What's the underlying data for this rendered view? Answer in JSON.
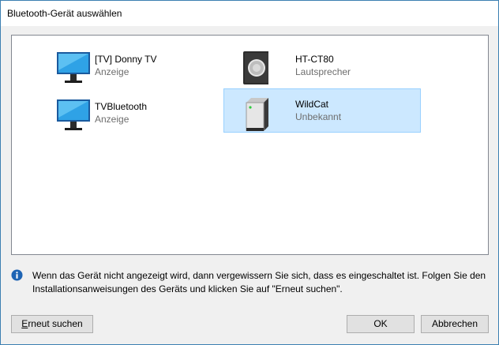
{
  "window": {
    "title": "Bluetooth-Gerät auswählen"
  },
  "devices": [
    {
      "name": "[TV] Donny TV",
      "type": "Anzeige",
      "icon": "monitor-icon",
      "selected": false
    },
    {
      "name": "HT-CT80",
      "type": "Lautsprecher",
      "icon": "speaker-icon",
      "selected": false
    },
    {
      "name": "TVBluetooth",
      "type": "Anzeige",
      "icon": "monitor-icon",
      "selected": false
    },
    {
      "name": "WildCat",
      "type": "Unbekannt",
      "icon": "unknown-device-icon",
      "selected": true
    }
  ],
  "info": {
    "icon": "info-icon",
    "text": "Wenn das Gerät nicht angezeigt wird, dann vergewissern Sie sich, dass es eingeschaltet ist. Folgen Sie den Installationsanweisungen des Geräts und klicken Sie auf \"Erneut suchen\"."
  },
  "buttons": {
    "retry_first": "E",
    "retry_rest": "rneut suchen",
    "ok": "OK",
    "cancel": "Abbrechen"
  },
  "colors": {
    "accent": "#0078d7",
    "selection_bg": "#cce8ff",
    "selection_border": "#99d1ff",
    "secondary_text": "#6d6d6d"
  }
}
